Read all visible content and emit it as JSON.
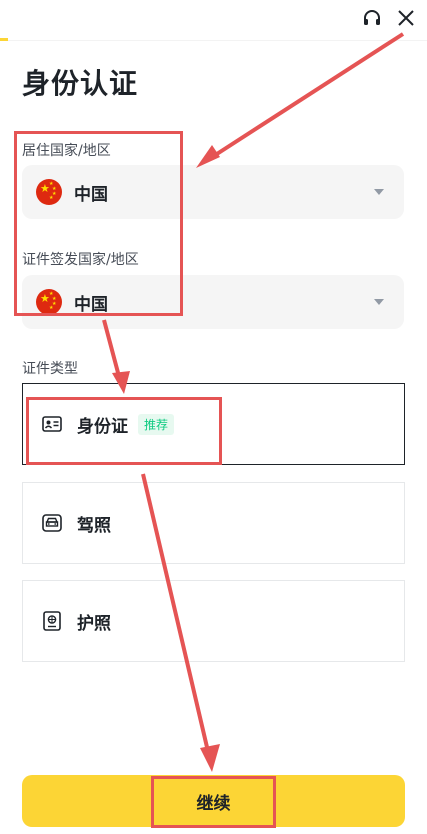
{
  "header": {
    "headset_icon": "headset-icon",
    "close_icon": "close-icon"
  },
  "page": {
    "title": "身份认证"
  },
  "residence": {
    "label": "居住国家/地区",
    "value": "中国",
    "flag_icon": "china-flag-icon"
  },
  "issuing": {
    "label": "证件签发国家/地区",
    "value": "中国",
    "flag_icon": "china-flag-icon"
  },
  "documents": {
    "label": "证件类型",
    "options": [
      {
        "label": "身份证",
        "badge": "推荐",
        "icon": "id-card-icon",
        "selected": true
      },
      {
        "label": "驾照",
        "icon": "driver-license-icon",
        "selected": false
      },
      {
        "label": "护照",
        "icon": "passport-icon",
        "selected": false
      }
    ]
  },
  "footer": {
    "continue_label": "继续"
  },
  "colors": {
    "accent": "#fcd535",
    "annotation": "#e55454",
    "badge_green": "#0ecb81"
  }
}
